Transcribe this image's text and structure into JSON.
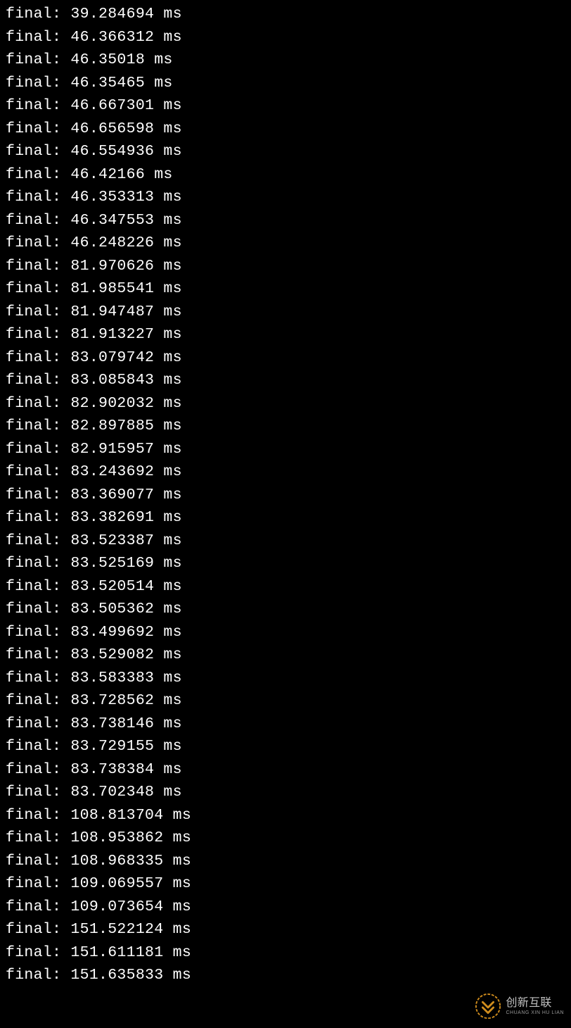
{
  "log": {
    "prefix": "final:",
    "unit": "ms",
    "values": [
      "39.284694",
      "46.366312",
      "46.35018",
      "46.35465",
      "46.667301",
      "46.656598",
      "46.554936",
      "46.42166",
      "46.353313",
      "46.347553",
      "46.248226",
      "81.970626",
      "81.985541",
      "81.947487",
      "81.913227",
      "83.079742",
      "83.085843",
      "82.902032",
      "82.897885",
      "82.915957",
      "83.243692",
      "83.369077",
      "83.382691",
      "83.523387",
      "83.525169",
      "83.520514",
      "83.505362",
      "83.499692",
      "83.529082",
      "83.583383",
      "83.728562",
      "83.738146",
      "83.729155",
      "83.738384",
      "83.702348",
      "108.813704",
      "108.953862",
      "108.968335",
      "109.069557",
      "109.073654",
      "151.522124",
      "151.611181",
      "151.635833"
    ]
  },
  "watermark": {
    "cn": "创新互联",
    "en": "CHUANG XIN HU LIAN"
  }
}
